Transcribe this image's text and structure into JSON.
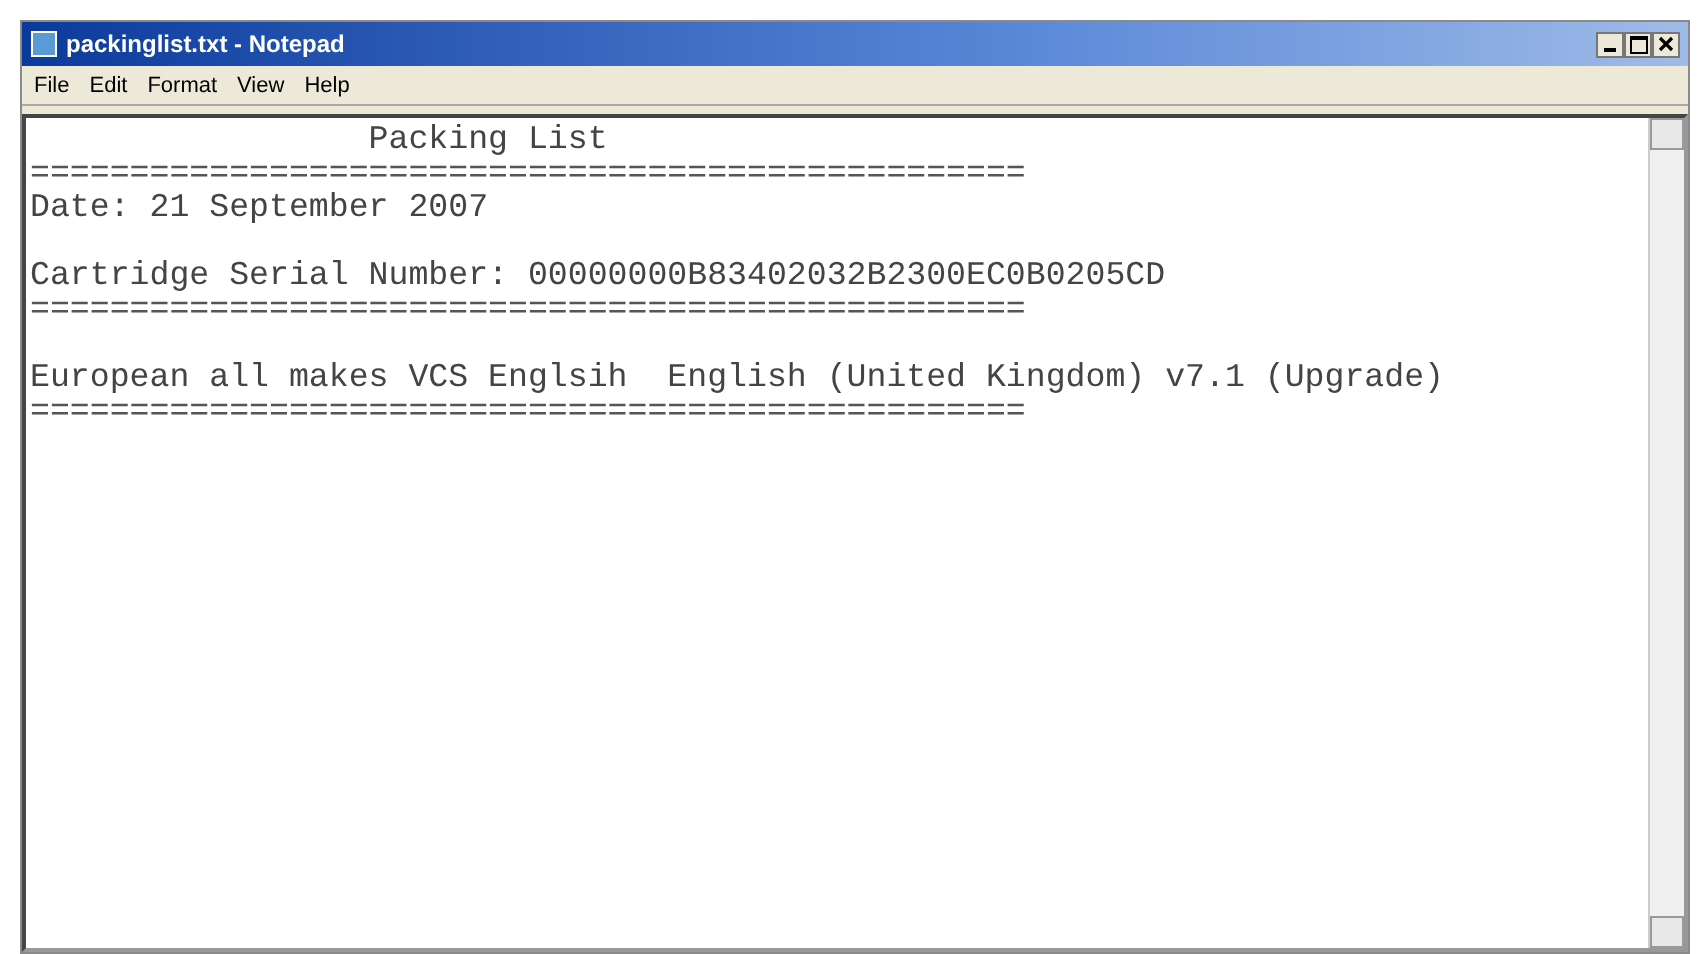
{
  "window": {
    "title": "packinglist.txt - Notepad"
  },
  "menu": [
    "File",
    "Edit",
    "Format",
    "View",
    "Help"
  ],
  "document": {
    "lines": [
      {
        "kind": "text",
        "text": "                 Packing List"
      },
      {
        "kind": "rule",
        "text": "=================================================="
      },
      {
        "kind": "text",
        "text": "Date: 21 September 2007"
      },
      {
        "kind": "blank"
      },
      {
        "kind": "text",
        "text": "Cartridge Serial Number: 00000000B83402032B2300EC0B0205CD"
      },
      {
        "kind": "rule",
        "text": "=================================================="
      },
      {
        "kind": "blank"
      },
      {
        "kind": "text",
        "text": "European all makes VCS Englsih  English (United Kingdom) v7.1 (Upgrade)"
      },
      {
        "kind": "rule",
        "text": "=================================================="
      }
    ]
  }
}
